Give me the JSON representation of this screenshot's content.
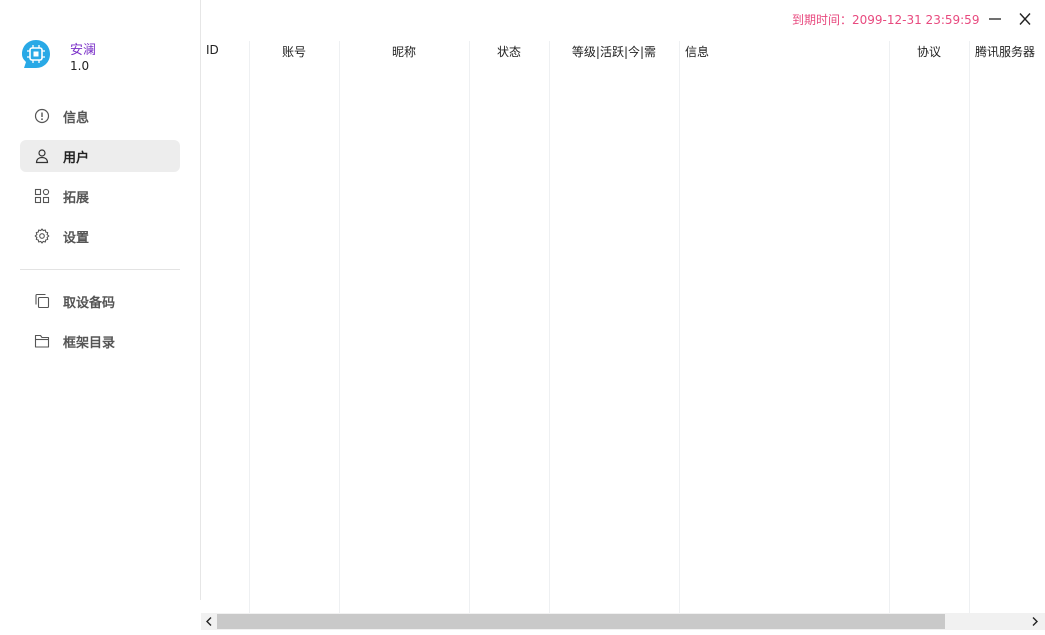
{
  "app": {
    "name": "安澜",
    "version": "1.0",
    "accent_color": "#7a2fc8",
    "logo_color": "#29a9e6"
  },
  "titlebar": {
    "expire_text": "到期时间：2099-12-31 23:59:59",
    "expire_color": "#e84a7f",
    "minimize_icon": "minimize-icon",
    "close_icon": "close-icon"
  },
  "sidebar": {
    "items": [
      {
        "label": "信息",
        "icon": "info-circle-icon",
        "active": false
      },
      {
        "label": "用户",
        "icon": "user-icon",
        "active": true
      },
      {
        "label": "拓展",
        "icon": "apps-grid-icon",
        "active": false
      },
      {
        "label": "设置",
        "icon": "gear-icon",
        "active": false
      }
    ],
    "tools": [
      {
        "label": "取设备码",
        "icon": "copy-icon"
      },
      {
        "label": "框架目录",
        "icon": "folder-icon"
      }
    ]
  },
  "table": {
    "columns": [
      "ID",
      "账号",
      "昵称",
      "状态",
      "等级|活跃|今|需",
      "信息",
      "协议",
      "腾讯服务器"
    ],
    "rows": []
  }
}
